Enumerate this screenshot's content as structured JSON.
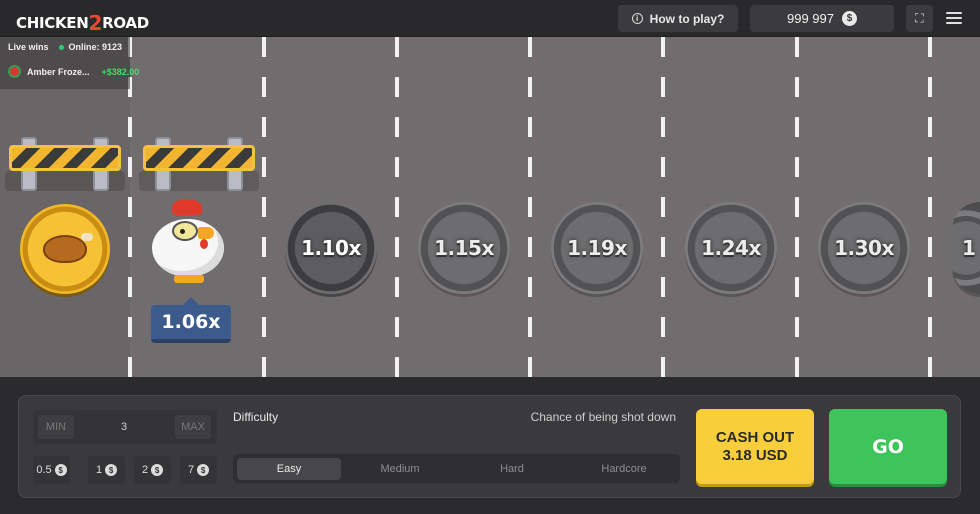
{
  "header": {
    "logo_left": "CHICKEN",
    "logo_mid": "2",
    "logo_right": "ROAD",
    "how_to_play": "How to play?",
    "balance": "999 997",
    "currency_symbol": "$"
  },
  "live_wins": {
    "title": "Live wins",
    "online": "Online: 9123",
    "entries": [
      {
        "name": "Amber Froze...",
        "amount": "+$382.00"
      }
    ]
  },
  "game": {
    "current_multiplier": "1.06x",
    "lanes": [
      "1.10x",
      "1.15x",
      "1.19x",
      "1.24x",
      "1.30x",
      "1"
    ]
  },
  "controls": {
    "min_label": "MIN",
    "max_label": "MAX",
    "bet_value": "3",
    "chips": [
      "0.5",
      "1",
      "2",
      "7"
    ],
    "difficulty_label": "Difficulty",
    "chance_label": "Chance of being shot down",
    "difficulties": [
      "Easy",
      "Medium",
      "Hard",
      "Hardcore"
    ],
    "selected_difficulty": "Easy",
    "cashout_line1": "CASH OUT",
    "cashout_line2": "3.18 USD",
    "go_label": "GO"
  },
  "colors": {
    "accent_yellow": "#f8cf3a",
    "accent_green": "#3ec45a",
    "road": "#716c6d",
    "multiplier_tag": "#3c5a8c"
  }
}
